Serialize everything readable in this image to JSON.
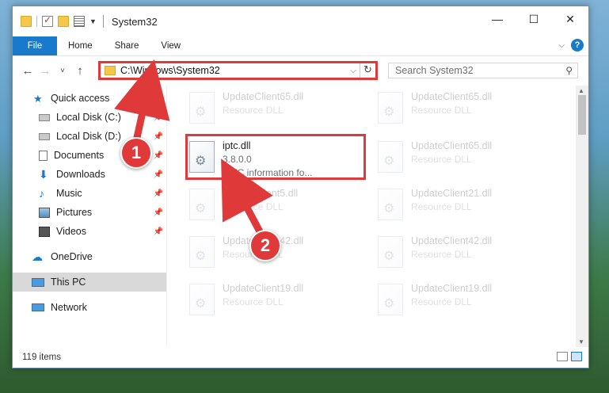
{
  "window": {
    "title": "System32",
    "controls": {
      "minimize": "—",
      "maximize": "☐",
      "close": "✕"
    }
  },
  "ribbon": {
    "tabs": [
      "File",
      "Home",
      "Share",
      "View"
    ],
    "help": "?"
  },
  "nav": {
    "back": "←",
    "forward": "→",
    "recent": "˅",
    "up": "↑",
    "address": "C:\\Windows\\System32",
    "search_placeholder": "Search System32"
  },
  "sidebar": {
    "items": [
      {
        "label": "Quick access",
        "icon": "star-icon"
      },
      {
        "label": "Local Disk (C:)",
        "icon": "drive-icon",
        "pinned": true
      },
      {
        "label": "Local Disk (D:)",
        "icon": "drive-icon",
        "pinned": true
      },
      {
        "label": "Documents",
        "icon": "documents-icon",
        "pinned": true
      },
      {
        "label": "Downloads",
        "icon": "downloads-icon",
        "pinned": true
      },
      {
        "label": "Music",
        "icon": "music-icon",
        "pinned": true
      },
      {
        "label": "Pictures",
        "icon": "pictures-icon",
        "pinned": true
      },
      {
        "label": "Videos",
        "icon": "videos-icon",
        "pinned": true
      },
      {
        "label": "OneDrive",
        "icon": "cloud-icon"
      },
      {
        "label": "This PC",
        "icon": "pc-icon",
        "selected": true
      },
      {
        "label": "Network",
        "icon": "network-icon"
      }
    ]
  },
  "files": {
    "highlighted": {
      "name": "iptc.dll",
      "version": "3.8.0.0",
      "description": "IPTC information fo..."
    },
    "ghost": [
      {
        "name": "UpdateClient65.dll",
        "type": "Resource DLL"
      },
      {
        "name": "UpdateClient65.dll",
        "type": "Resource DLL"
      },
      {
        "name": "UpdateClient65.dll",
        "type": "Resource DLL"
      },
      {
        "name": "UpdateClient5.dll",
        "type": "Resource DLL"
      },
      {
        "name": "UpdateClient21.dll",
        "type": "Resource DLL"
      },
      {
        "name": "UpdateClient42.dll",
        "type": "Resource DLL"
      },
      {
        "name": "UpdateClient42.dll",
        "type": "Resource DLL"
      },
      {
        "name": "UpdateClient19.dll",
        "type": "Resource DLL"
      },
      {
        "name": "UpdateClient19.dll",
        "type": "Resource DLL"
      }
    ]
  },
  "status": {
    "item_count": "119 items"
  },
  "annotations": {
    "step1": "1",
    "step2": "2",
    "color": "#e0393a"
  }
}
